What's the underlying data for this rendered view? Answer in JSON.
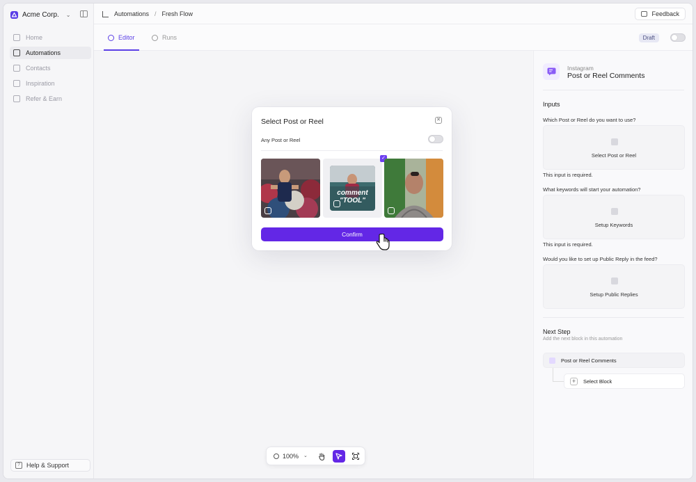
{
  "sidebar": {
    "org_name": "Acme Corp.",
    "items": [
      {
        "label": "Home",
        "icon": "home-icon"
      },
      {
        "label": "Automations",
        "icon": "automations-icon"
      },
      {
        "label": "Contacts",
        "icon": "contacts-icon"
      },
      {
        "label": "Inspiration",
        "icon": "inspiration-icon"
      },
      {
        "label": "Refer & Earn",
        "icon": "gift-icon"
      }
    ],
    "help_label": "Help & Support"
  },
  "header": {
    "breadcrumb": [
      "Automations",
      "Fresh Flow"
    ],
    "breadcrumb_sep": "/",
    "feedback_label": "Feedback"
  },
  "tabs": [
    {
      "label": "Editor",
      "active": true
    },
    {
      "label": "Runs",
      "active": false
    }
  ],
  "status": {
    "draft_label": "Draft"
  },
  "modal": {
    "title": "Select Post or Reel",
    "any_label": "Any Post or Reel",
    "thumb_text_line1": "comment",
    "thumb_text_line2": "\"TOOL\"",
    "confirm_label": "Confirm"
  },
  "zoom": {
    "value": "100%"
  },
  "panel": {
    "platform": "Instagram",
    "title": "Post or Reel Comments",
    "inputs_heading": "Inputs",
    "q1": "Which Post or Reel do you want to use?",
    "box1": "Select Post or Reel",
    "required1": "This input is required.",
    "q2": "What keywords will start your automation?",
    "box2": "Setup Keywords",
    "required2": "This input is required.",
    "q3": "Would you like to set up Public Reply in the feed?",
    "box3": "Setup Public Replies",
    "next_heading": "Next Step",
    "next_note": "Add the next block in this automation",
    "step_label": "Post or Reel Comments",
    "select_block": "Select Block"
  },
  "colors": {
    "accent": "#6327e6",
    "brand": "#5b3fe6"
  }
}
